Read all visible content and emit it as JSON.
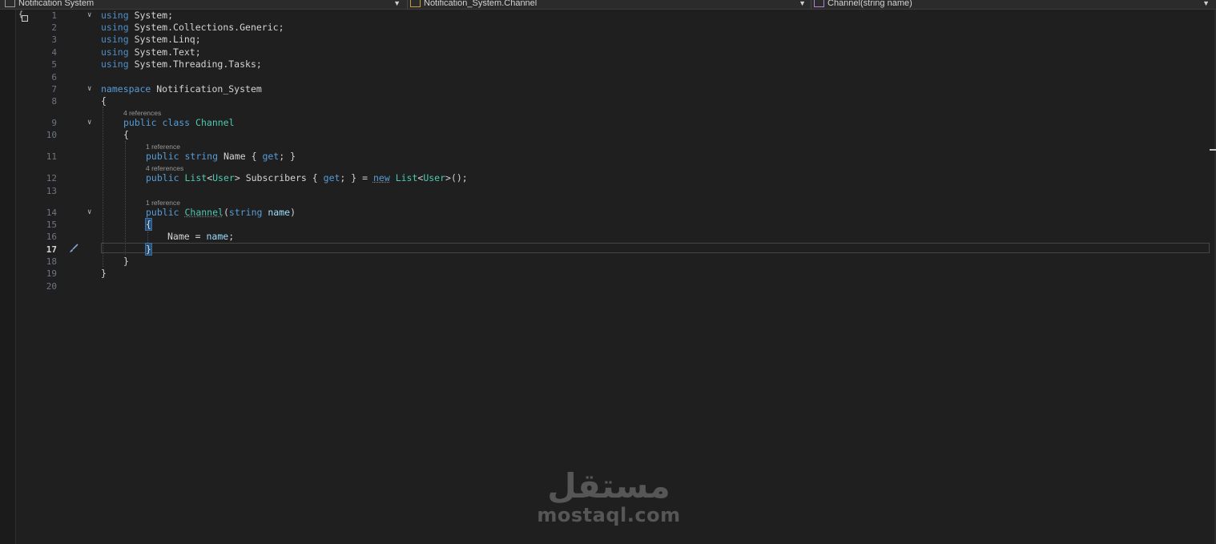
{
  "navbar": {
    "project": "Notification System",
    "type": "Notification_System.Channel",
    "member": "Channel(string name)"
  },
  "lines": [
    {
      "n": "1",
      "t": "using System;"
    },
    {
      "n": "2",
      "t": "using System.Collections.Generic;"
    },
    {
      "n": "3",
      "t": "using System.Linq;"
    },
    {
      "n": "4",
      "t": "using System.Text;"
    },
    {
      "n": "5",
      "t": "using System.Threading.Tasks;"
    },
    {
      "n": "6",
      "t": ""
    },
    {
      "n": "7",
      "t": "namespace Notification_System"
    },
    {
      "n": "8",
      "t": "{"
    },
    {
      "n": "9",
      "t": "public class Channel"
    },
    {
      "n": "10",
      "t": "{"
    },
    {
      "n": "11",
      "t": "public string Name { get; }"
    },
    {
      "n": "12",
      "t": "public List<User> Subscribers { get; } = new List<User>();"
    },
    {
      "n": "13",
      "t": ""
    },
    {
      "n": "14",
      "t": "public Channel(string name)"
    },
    {
      "n": "15",
      "t": "{"
    },
    {
      "n": "16",
      "t": "Name = name;"
    },
    {
      "n": "17",
      "t": "}"
    },
    {
      "n": "18",
      "t": "}"
    },
    {
      "n": "19",
      "t": "}"
    },
    {
      "n": "20",
      "t": ""
    }
  ],
  "code": {
    "kw_using": "using",
    "ns_system": "System",
    "ns_collections_generic": "System.Collections.Generic",
    "ns_linq": "System.Linq",
    "ns_text": "System.Text",
    "ns_threading_tasks": "System.Threading.Tasks",
    "kw_namespace": "namespace",
    "ns_name": "Notification_System",
    "kw_public": "public",
    "kw_class": "class",
    "class_name": "Channel",
    "kw_string": "string",
    "prop_name": "Name",
    "kw_get": "get",
    "type_list": "List",
    "type_user": "User",
    "prop_subscribers": "Subscribers",
    "kw_new": "new",
    "param_name": "name"
  },
  "codelens": {
    "class_refs": "4 references",
    "name_refs": "1 reference",
    "subscribers_refs": "4 references",
    "ctor_refs": "1 reference"
  },
  "current_line": "17",
  "watermark": {
    "arabic": "مستقل",
    "latin": "mostaql.com"
  },
  "colors": {
    "background": "#1f1f1f",
    "keyword": "#569cd6",
    "type": "#4ec9b0",
    "parameter": "#9cdcfe",
    "text": "#d4d4d4",
    "line_number": "#6e7681"
  },
  "icons": [
    "scope-icon",
    "chevron-down-icon",
    "paintbrush-icon"
  ]
}
